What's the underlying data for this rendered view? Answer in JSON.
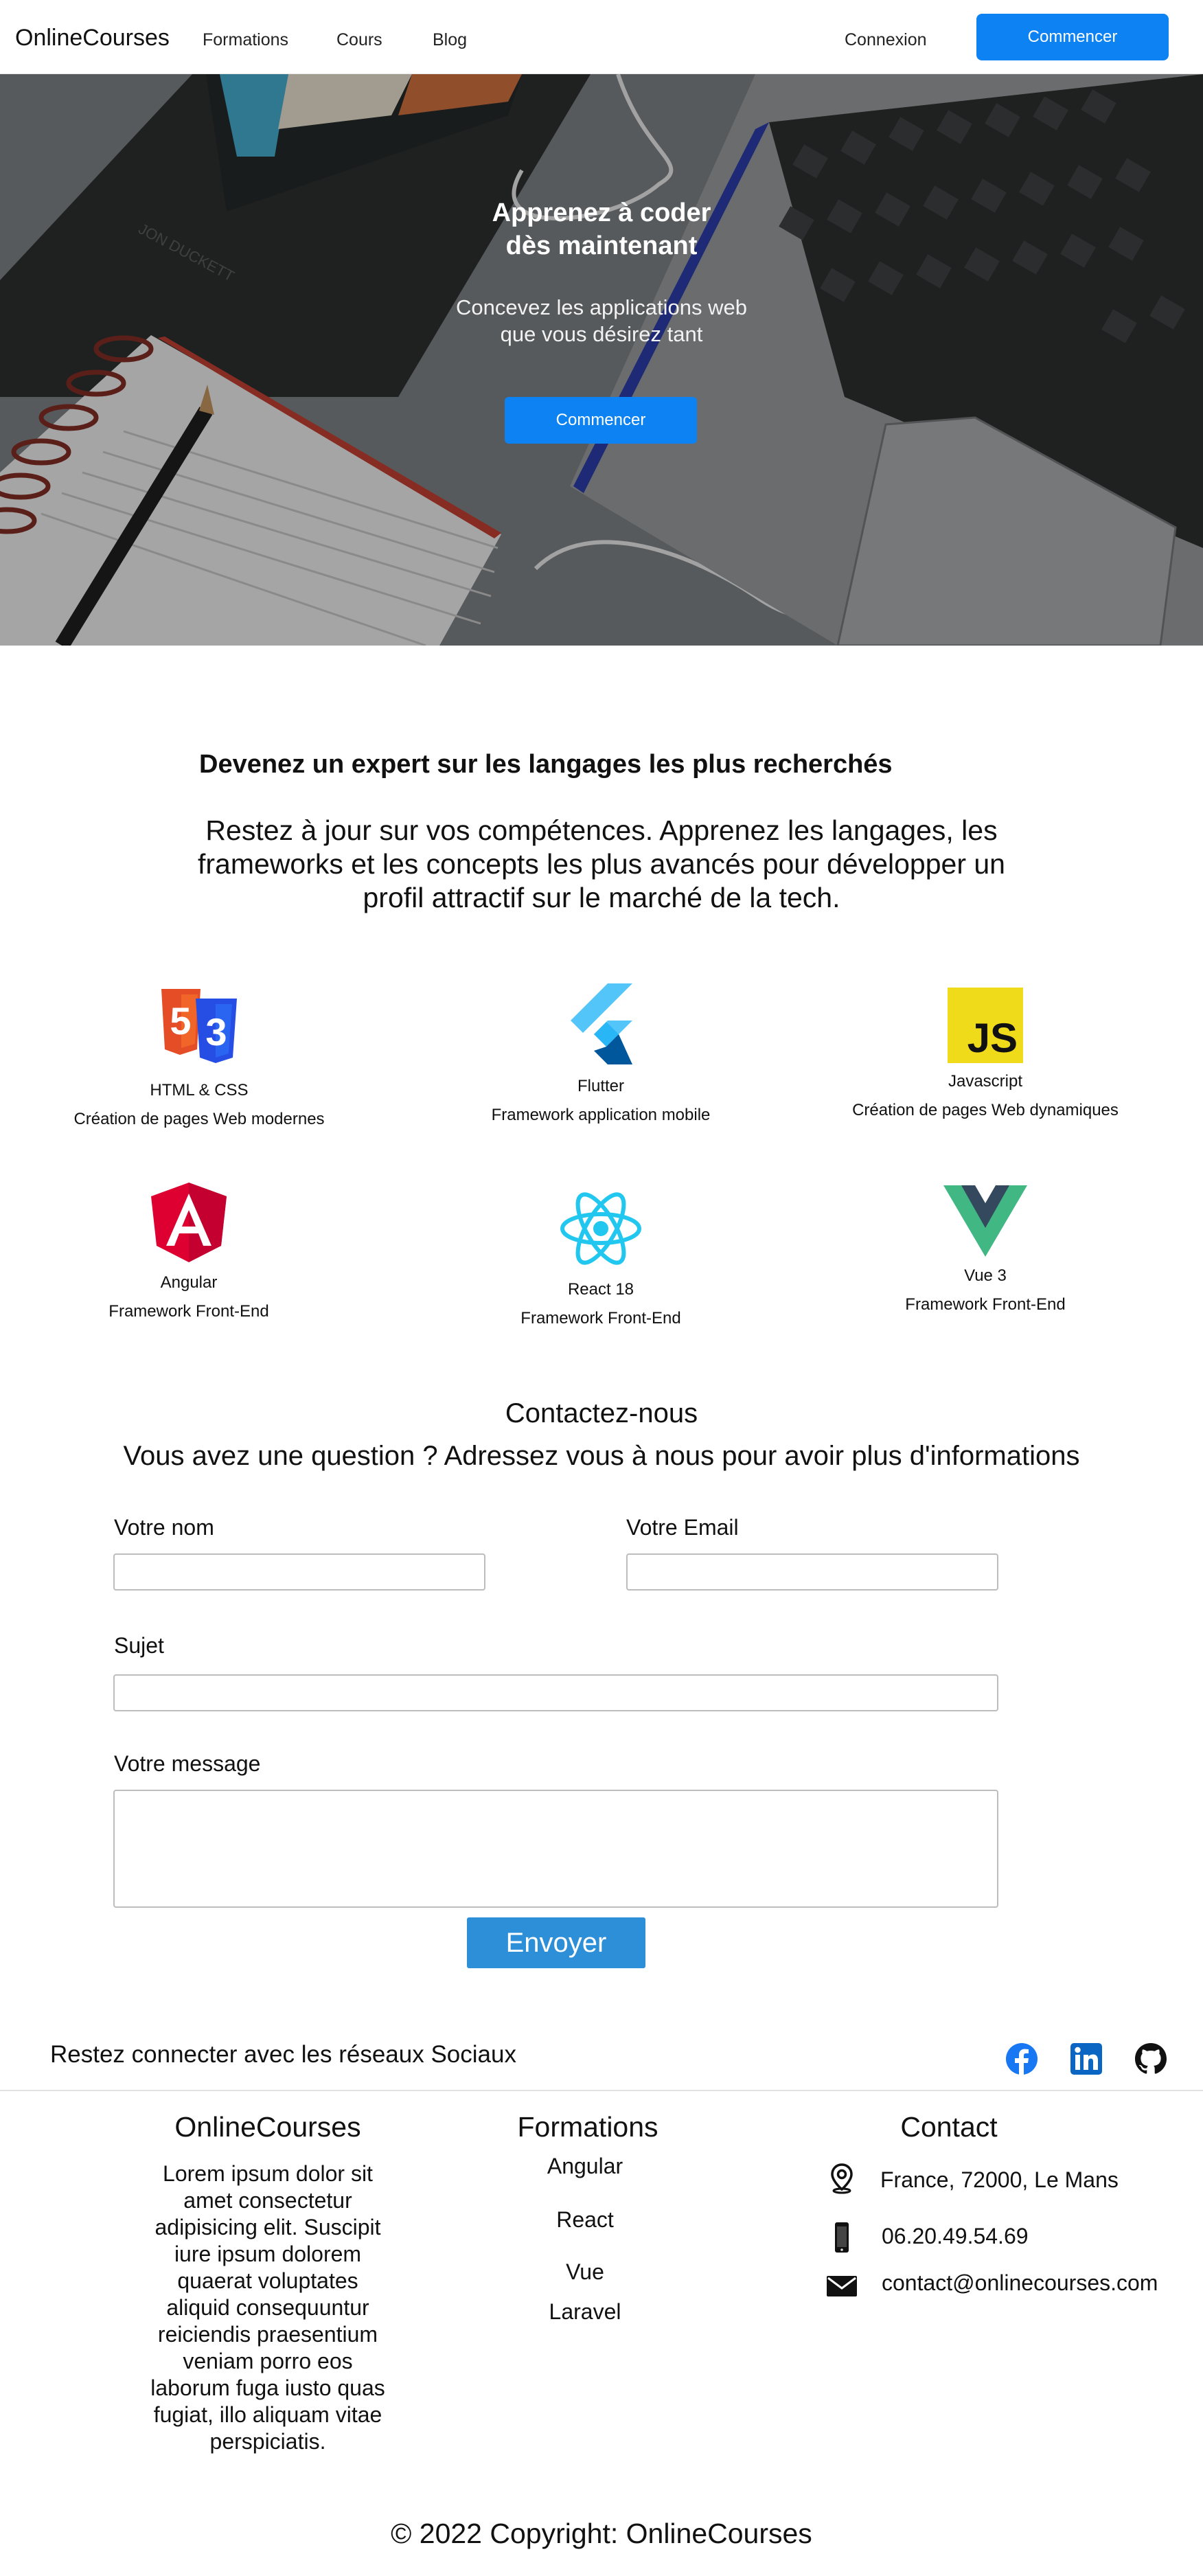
{
  "nav": {
    "brand": "OnlineCourses",
    "links": [
      "Formations",
      "Cours",
      "Blog"
    ],
    "login": "Connexion",
    "cta": "Commencer"
  },
  "hero": {
    "title_line1": "Apprenez à coder",
    "title_line2": "dès maintenant",
    "subtitle_line1": "Concevez les applications web",
    "subtitle_line2": "que vous désirez tant",
    "cta": "Commencer",
    "book_text": "JON DUCKETT"
  },
  "expert": {
    "title": "Devenez un expert sur les langages les plus recherchés",
    "description": "Restez à jour sur vos compétences. Apprenez les langages, les frameworks et les concepts les plus avancés pour développer un profil attractif sur le marché de la tech."
  },
  "technologies": [
    {
      "name": "HTML & CSS",
      "desc": "Création de pages Web modernes",
      "icon": "html-css-icon"
    },
    {
      "name": "Flutter",
      "desc": "Framework application mobile",
      "icon": "flutter-icon"
    },
    {
      "name": "Javascript",
      "desc": "Création de pages Web dynamiques",
      "icon": "javascript-icon",
      "icon_text": "JS"
    },
    {
      "name": "Angular",
      "desc": "Framework Front-End",
      "icon": "angular-icon"
    },
    {
      "name": "React 18",
      "desc": "Framework Front-End",
      "icon": "react-icon"
    },
    {
      "name": "Vue 3",
      "desc": "Framework Front-End",
      "icon": "vue-icon"
    }
  ],
  "contact": {
    "title": "Contactez-nous",
    "subtitle": "Vous avez une question ? Adressez vous à nous pour avoir plus d'informations",
    "name_label": "Votre nom",
    "email_label": "Votre Email",
    "subject_label": "Sujet",
    "message_label": "Votre message",
    "name_value": "",
    "email_value": "",
    "subject_value": "",
    "message_value": "",
    "submit": "Envoyer"
  },
  "social": {
    "text": "Restez connecter avec les réseaux Sociaux",
    "icons": [
      "facebook-icon",
      "linkedin-icon",
      "github-icon"
    ],
    "colors": {
      "facebook": "#1877f2",
      "linkedin": "#0a66c2",
      "github": "#111111"
    }
  },
  "footer": {
    "about_title": "OnlineCourses",
    "about_text": "Lorem ipsum dolor sit amet consectetur adipisicing elit. Suscipit iure ipsum dolorem quaerat voluptates aliquid consequuntur reiciendis praesentium veniam porro eos laborum fuga iusto quas fugiat, illo aliquam vitae perspiciatis.",
    "formations_title": "Formations",
    "formations": [
      "Angular",
      "React",
      "Vue",
      "Laravel"
    ],
    "contact_title": "Contact",
    "address": "France, 72000, Le Mans",
    "phone": "06.20.49.54.69",
    "email": "contact@onlinecourses.com",
    "copyright": "© 2022 Copyright: OnlineCourses"
  },
  "colors": {
    "accent": "#0d82f2",
    "submit": "#2c8fd8"
  }
}
